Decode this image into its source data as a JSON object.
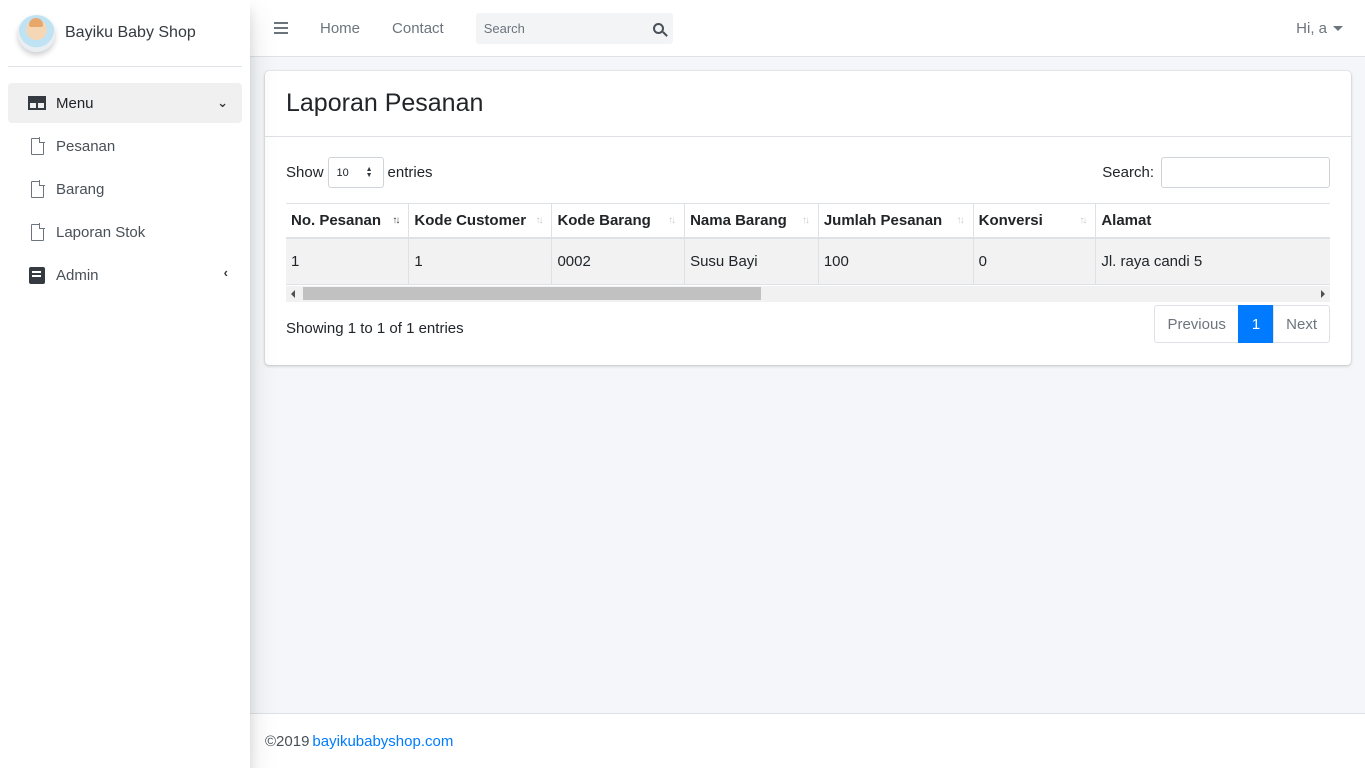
{
  "brand": {
    "name": "Bayiku Baby Shop"
  },
  "sidebar": {
    "items": [
      {
        "label": "Menu",
        "icon": "table-icon",
        "active": true
      },
      {
        "label": "Pesanan",
        "icon": "file-icon"
      },
      {
        "label": "Barang",
        "icon": "file-icon"
      },
      {
        "label": "Laporan Stok",
        "icon": "file-icon"
      },
      {
        "label": "Admin",
        "icon": "book-icon"
      }
    ]
  },
  "topbar": {
    "links": [
      "Home",
      "Contact"
    ],
    "search_placeholder": "Search",
    "user": "Hi, a"
  },
  "page": {
    "title": "Laporan Pesanan",
    "show_label": "Show",
    "entries_label": "entries",
    "length_value": "10",
    "search_label": "Search:",
    "info": "Showing 1 to 1 of 1 entries"
  },
  "table": {
    "headers": [
      "No. Pesanan",
      "Kode Customer",
      "Kode Barang",
      "Nama Barang",
      "Jumlah Pesanan",
      "Konversi",
      "Alamat"
    ],
    "rows": [
      [
        "1",
        "1",
        "0002",
        "Susu Bayi",
        "100",
        "0",
        "Jl. raya candi 5"
      ]
    ]
  },
  "pagination": {
    "previous": "Previous",
    "current": "1",
    "next": "Next"
  },
  "footer": {
    "copyright": "©2019",
    "link": "bayikubabyshop.com"
  },
  "colors": {
    "accent": "#007bff",
    "sidebar_active": "#f0f0f0"
  }
}
